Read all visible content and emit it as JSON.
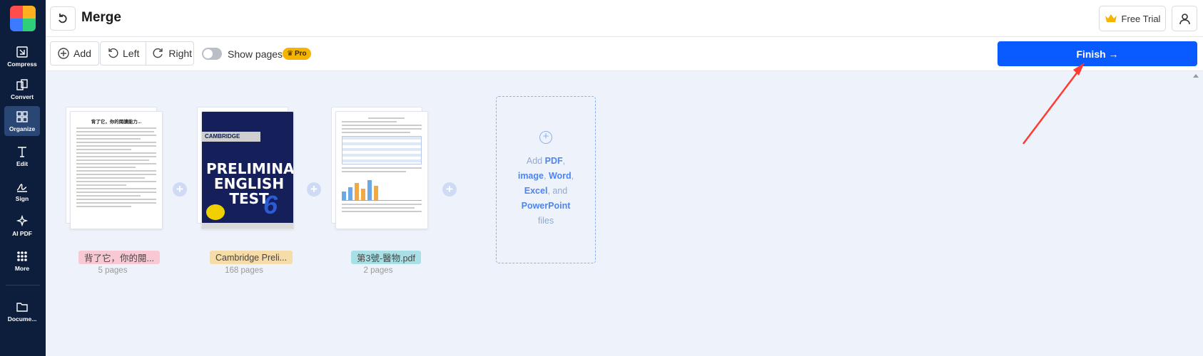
{
  "sidebar": {
    "items": [
      {
        "label": "Compress",
        "icon": "compress-icon"
      },
      {
        "label": "Convert",
        "icon": "convert-icon"
      },
      {
        "label": "Organize",
        "icon": "organize-icon",
        "active": true
      },
      {
        "label": "Edit",
        "icon": "edit-text-icon"
      },
      {
        "label": "Sign",
        "icon": "sign-icon"
      },
      {
        "label": "AI PDF",
        "icon": "ai-sparkle-icon"
      },
      {
        "label": "More",
        "icon": "grid-dots-icon"
      },
      {
        "label": "Docume...",
        "icon": "folder-icon"
      }
    ]
  },
  "header": {
    "title": "Merge",
    "trial_label": "Free Trial"
  },
  "toolbar": {
    "add_label": "Add",
    "left_label": "Left",
    "right_label": "Right",
    "show_pages_label": "Show pages",
    "pro_label": "Pro",
    "finish_label": "Finish →"
  },
  "files": [
    {
      "name": "背了它，你的閱...",
      "pages": "5 pages",
      "tag_color": "#f8c9d4",
      "doc_heading": "背了它，你的閱讀能力..."
    },
    {
      "name": "Cambridge Preli...",
      "pages": "168 pages",
      "tag_color": "#f6dca8",
      "book_brand": "CAMBRIDGE",
      "book_title": "PRELIMINARY ENGLISH TEST",
      "book_number": "6"
    },
    {
      "name": "第3號-醫物.pdf",
      "pages": "2 pages",
      "tag_color": "#a9e0e6"
    }
  ],
  "add_zone": {
    "line1_pre": "Add ",
    "pdf": "PDF",
    "comma1": ",",
    "image": "image",
    "comma2": ", ",
    "word": "Word",
    "comma3": ",",
    "excel": "Excel",
    "and": ", and",
    "powerpoint": "PowerPoint",
    "files": "files"
  },
  "colors": {
    "sidebar_bg": "#0d1e3d",
    "accent": "#0a5bff",
    "pro_badge": "#f6b400",
    "annotation_arrow": "#ff3b30"
  }
}
